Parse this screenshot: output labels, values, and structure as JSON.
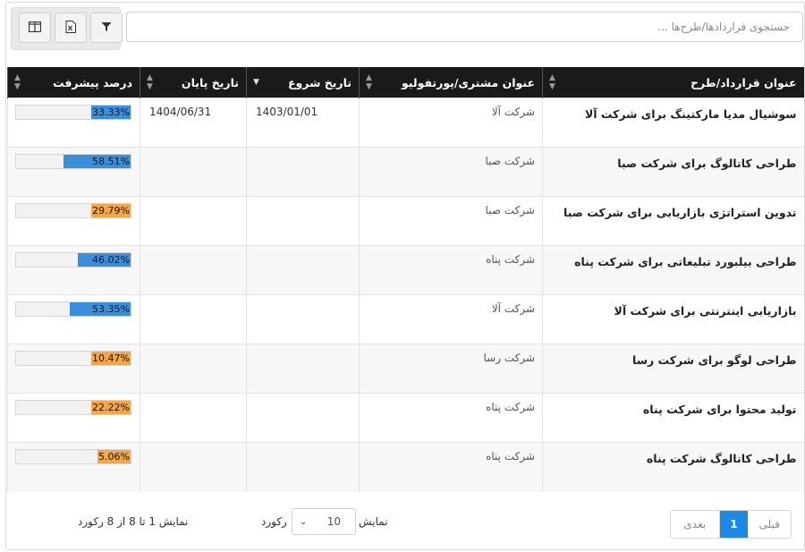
{
  "search": {
    "placeholder": "جستجوی قراردادها/طرح‌ها ..."
  },
  "toolbar": {
    "columns_icon": "columns-icon",
    "excel_icon": "excel-icon",
    "filter_icon": "filter-icon"
  },
  "table": {
    "headers": {
      "title": "عنوان قرارداد/طرح",
      "client": "عنوان مشتری/پورتفولیو",
      "start": "تاریخ شروع",
      "end": "تاریخ پایان",
      "progress": "درصد پیشرفت"
    },
    "rows": [
      {
        "title": "سوشیال مدیا مارکتینگ برای شرکت آلا",
        "client": "شرکت آلا",
        "start": "1403/01/01",
        "end": "1404/06/31",
        "progress": 33.33,
        "progress_label": "33.33%",
        "color": "#3a8fdc"
      },
      {
        "title": "طراحی کاتالوگ برای شرکت صبا",
        "client": "شرکت صبا",
        "start": "",
        "end": "",
        "progress": 58.51,
        "progress_label": "58.51%",
        "color": "#3a8fdc"
      },
      {
        "title": "تدوین استراتژی بازاریابی برای شرکت صبا",
        "client": "شرکت صبا",
        "start": "",
        "end": "",
        "progress": 29.79,
        "progress_label": "29.79%",
        "color": "#f5a742"
      },
      {
        "title": "طراحی بیلبورد تبلیغاتی برای شرکت پناه",
        "client": "شرکت پناه",
        "start": "",
        "end": "",
        "progress": 46.02,
        "progress_label": "46.02%",
        "color": "#3a8fdc"
      },
      {
        "title": "بازاریابی اینترنتی برای شرکت آلا",
        "client": "شرکت آلا",
        "start": "",
        "end": "",
        "progress": 53.35,
        "progress_label": "53.35%",
        "color": "#3a8fdc"
      },
      {
        "title": "طراحی لوگو برای شرکت رسا",
        "client": "شرکت رسا",
        "start": "",
        "end": "",
        "progress": 10.47,
        "progress_label": "10.47%",
        "color": "#f5a742"
      },
      {
        "title": "تولید محتوا برای شرکت پناه",
        "client": "شرکت پناه",
        "start": "",
        "end": "",
        "progress": 22.22,
        "progress_label": "22.22%",
        "color": "#f5a742"
      },
      {
        "title": "طراحی کاتالوگ شرکت پناه",
        "client": "شرکت پناه",
        "start": "",
        "end": "",
        "progress": 5.06,
        "progress_label": "5.06%",
        "color": "#f5a742"
      }
    ]
  },
  "footer": {
    "prev": "قبلی",
    "current_page": "1",
    "next": "بعدی",
    "show_label": "نمایش",
    "page_size": "10",
    "record_label": "رکورد",
    "summary": "نمایش 1 تا 8 از 8 رکورد"
  }
}
